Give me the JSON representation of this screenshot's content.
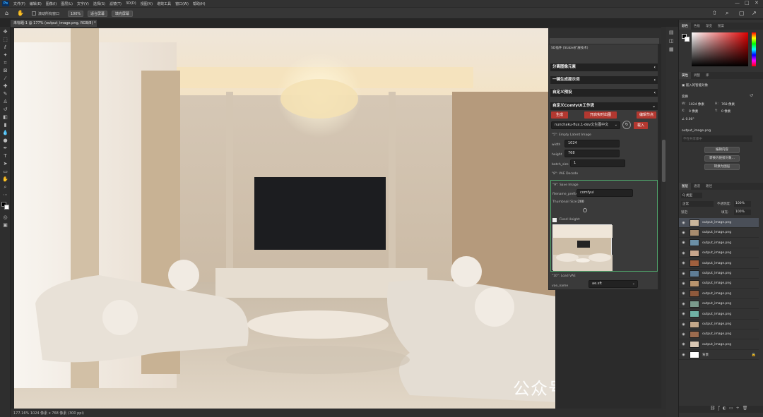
{
  "app": {
    "badge": "Ps",
    "menus": [
      "文件(F)",
      "编辑(E)",
      "图像(I)",
      "图层(L)",
      "文字(Y)",
      "选择(S)",
      "滤镜(T)",
      "3D(D)",
      "视图(V)",
      "增效工具",
      "窗口(W)",
      "帮助(H)"
    ]
  },
  "options": {
    "scroll_all": "滚动所有窗口",
    "zoom": "100%",
    "fit_screen": "适合屏幕",
    "fill_screen": "填充屏幕"
  },
  "document": {
    "tab": "未标题-1 @ 177% (output_image.png, RGB/8) *",
    "status": "177.16% 1024 像素 x 768 像素 (300 ppi)"
  },
  "watermark": "公众号 · 光影AI艺术",
  "comfy": {
    "title": "SD插件 (Stable扩展技术)",
    "sections": [
      "分离图像元素",
      "一键生成提示词",
      "自定义预设",
      "自定义ComfyUI工作流"
    ],
    "buttons": {
      "generate": "生成",
      "open_live": "开启实时出图",
      "edit_node": "编辑节点",
      "import": "载入"
    },
    "workflow": "nunchaku-flux.1-dev文生图中文",
    "empty_latent": {
      "title": "\"5\": Empty Latent Image",
      "width_label": "width",
      "width": "1024",
      "height_label": "height",
      "height": "768",
      "batch_label": "batch_size",
      "batch": "1"
    },
    "vae_decode": "\"8\": VAE Decode",
    "save_image": {
      "title": "\"9\": Save Image",
      "prefix_label": "filename_prefix",
      "prefix": "comfyui",
      "thumb_label": "Thumbnail Size:",
      "thumb_val": "200",
      "fixed_height": "Fixed Height:"
    },
    "load_vae": {
      "title": "\"10\": Load VAE",
      "label": "vae_name",
      "value": "ae.sft"
    }
  },
  "right": {
    "color_tabs": [
      "颜色",
      "色板",
      "渐变",
      "图案"
    ],
    "props_tabs": [
      "属性",
      "调整",
      "库"
    ],
    "smart_obj": "嵌入的智能对象",
    "transform": "变换",
    "w_label": "W:",
    "w": "1024 像素",
    "h_label": "H:",
    "h": "768 像素",
    "x_label": "X:",
    "x": "0 像素",
    "y_label": "Y:",
    "y": "0 像素",
    "angle": "0.00°",
    "filename": "output_image.png",
    "not_shared": "不在共享库中",
    "edit_content": "编辑内容",
    "convert_linked": "转换为链接对象...",
    "convert_layers": "转换为图层",
    "layers_tabs": [
      "图层",
      "通道",
      "路径"
    ],
    "kind": "Q 类型",
    "blend": "正常",
    "opacity_label": "不透明度:",
    "opacity": "100%",
    "lock": "锁定:",
    "fill_label": "填充:",
    "fill": "100%",
    "layers": [
      "output_image.png",
      "output_image.png",
      "output_image.png",
      "output_image.png",
      "output_image.png",
      "output_image.png",
      "output_image.png",
      "output_image.png",
      "output_image.png",
      "output_image.png",
      "output_image.png",
      "output_image.png",
      "output_image.png",
      "背景"
    ]
  }
}
